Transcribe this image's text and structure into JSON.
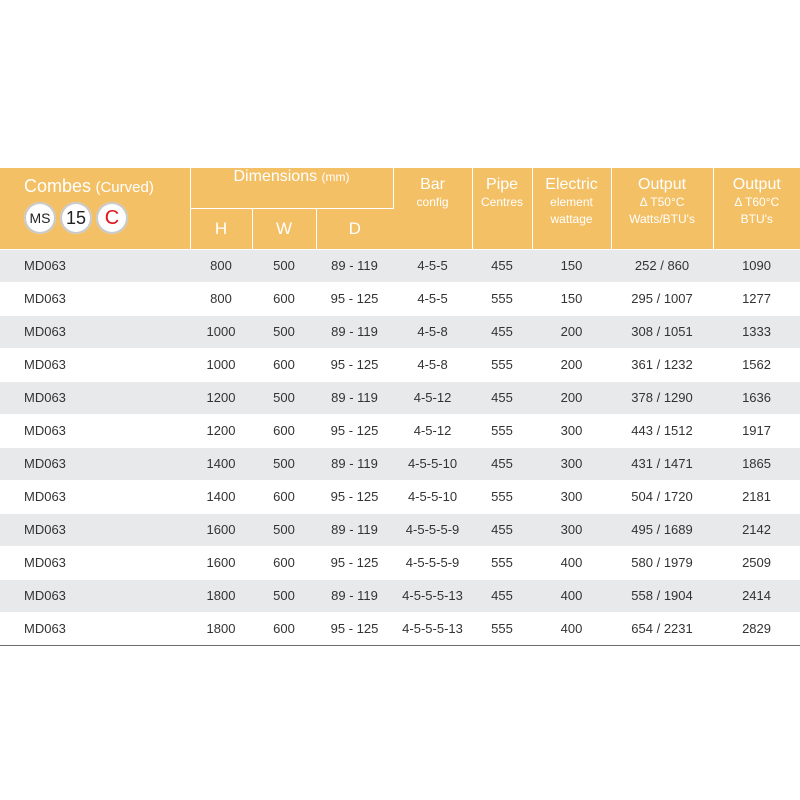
{
  "header": {
    "title_main": "Combes",
    "title_sub": "(Curved)",
    "badges": {
      "ms": "MS",
      "fifteen": "15",
      "c": "C"
    },
    "dimensions_label": "Dimensions",
    "dimensions_unit": "(mm)",
    "h_label": "H",
    "w_label": "W",
    "d_label": "D",
    "bar_label": "Bar",
    "bar_sub": "config",
    "pipe_label": "Pipe",
    "pipe_sub": "Centres",
    "electric_label": "Electric",
    "electric_sub1": "element",
    "electric_sub2": "wattage",
    "output50_label": "Output",
    "output50_sub1": "Δ T50°C",
    "output50_sub2": "Watts/BTU's",
    "output60_label": "Output",
    "output60_sub1": "Δ T60°C",
    "output60_sub2": "BTU's"
  },
  "rows": [
    [
      "MD063",
      "800",
      "500",
      "89 - 119",
      "4-5-5",
      "455",
      "150",
      "252 / 860",
      "1090"
    ],
    [
      "MD063",
      "800",
      "600",
      "95 - 125",
      "4-5-5",
      "555",
      "150",
      "295 / 1007",
      "1277"
    ],
    [
      "MD063",
      "1000",
      "500",
      "89 - 119",
      "4-5-8",
      "455",
      "200",
      "308 / 1051",
      "1333"
    ],
    [
      "MD063",
      "1000",
      "600",
      "95 - 125",
      "4-5-8",
      "555",
      "200",
      "361 / 1232",
      "1562"
    ],
    [
      "MD063",
      "1200",
      "500",
      "89 - 119",
      "4-5-12",
      "455",
      "200",
      "378 / 1290",
      "1636"
    ],
    [
      "MD063",
      "1200",
      "600",
      "95 - 125",
      "4-5-12",
      "555",
      "300",
      "443 / 1512",
      "1917"
    ],
    [
      "MD063",
      "1400",
      "500",
      "89 - 119",
      "4-5-5-10",
      "455",
      "300",
      "431 / 1471",
      "1865"
    ],
    [
      "MD063",
      "1400",
      "600",
      "95 - 125",
      "4-5-5-10",
      "555",
      "300",
      "504 / 1720",
      "2181"
    ],
    [
      "MD063",
      "1600",
      "500",
      "89 - 119",
      "4-5-5-5-9",
      "455",
      "300",
      "495 / 1689",
      "2142"
    ],
    [
      "MD063",
      "1600",
      "600",
      "95 - 125",
      "4-5-5-5-9",
      "555",
      "400",
      "580 / 1979",
      "2509"
    ],
    [
      "MD063",
      "1800",
      "500",
      "89 - 119",
      "4-5-5-5-13",
      "455",
      "400",
      "558 / 1904",
      "2414"
    ],
    [
      "MD063",
      "1800",
      "600",
      "95 - 125",
      "4-5-5-5-13",
      "555",
      "400",
      "654 / 2231",
      "2829"
    ]
  ],
  "colors": {
    "header_bg": "#f3c065",
    "row_alt_bg": "#e8e9ea",
    "badge_c_red": "#e3141b"
  }
}
